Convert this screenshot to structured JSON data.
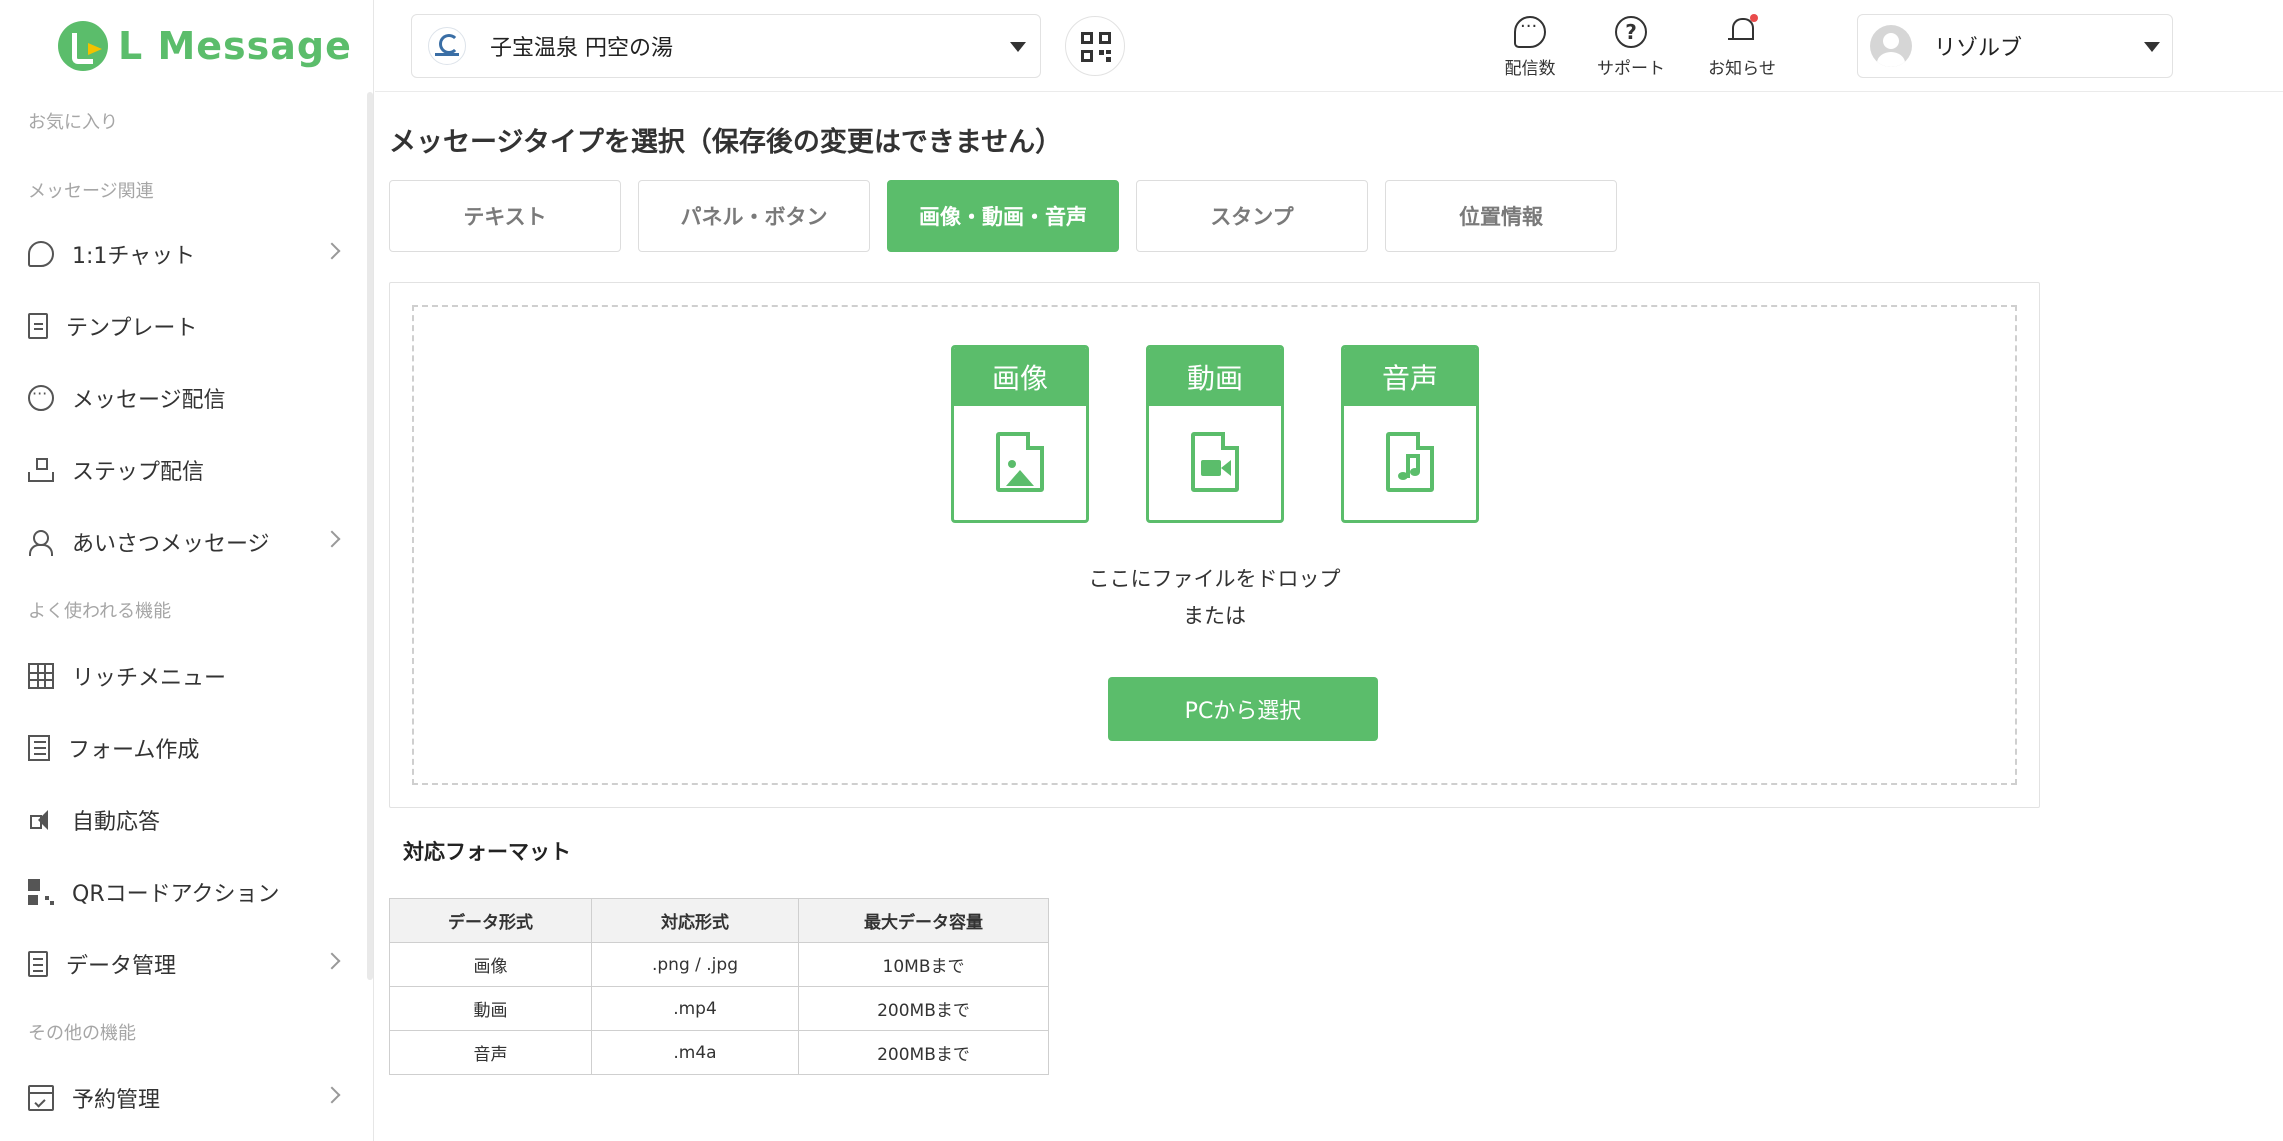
{
  "app": {
    "logo_text": "L Message",
    "accent_color": "#5bbd6b"
  },
  "sidebar": {
    "sections": [
      {
        "label": "お気に入り"
      },
      {
        "label": "メッセージ関連"
      },
      {
        "label": "よく使われる機能"
      },
      {
        "label": "その他の機能"
      }
    ],
    "items": [
      {
        "label": "1:1チャット",
        "icon": "chat-bubbles-icon",
        "has_submenu": true
      },
      {
        "label": "テンプレート",
        "icon": "document-icon",
        "has_submenu": false
      },
      {
        "label": "メッセージ配信",
        "icon": "message-icon",
        "has_submenu": false
      },
      {
        "label": "ステップ配信",
        "icon": "step-hierarchy-icon",
        "has_submenu": false
      },
      {
        "label": "あいさつメッセージ",
        "icon": "user-plus-icon",
        "has_submenu": true
      },
      {
        "label": "リッチメニュー",
        "icon": "grid-icon",
        "has_submenu": false
      },
      {
        "label": "フォーム作成",
        "icon": "form-icon",
        "has_submenu": false
      },
      {
        "label": "自動応答",
        "icon": "speaker-icon",
        "has_submenu": false
      },
      {
        "label": "QRコードアクション",
        "icon": "qr-code-icon",
        "has_submenu": false
      },
      {
        "label": "データ管理",
        "icon": "data-icon",
        "has_submenu": true
      },
      {
        "label": "予約管理",
        "icon": "calendar-icon",
        "has_submenu": true
      }
    ]
  },
  "header": {
    "account_name": "子宝温泉 円空の湯",
    "tools": [
      {
        "label": "配信数",
        "icon": "chat-icon"
      },
      {
        "label": "サポート",
        "icon": "help-icon"
      },
      {
        "label": "お知らせ",
        "icon": "bell-icon",
        "has_notification": true
      }
    ],
    "user_name": "リゾルブ"
  },
  "main": {
    "section_title": "メッセージタイプを選択（保存後の変更はできません）",
    "tabs": [
      {
        "label": "テキスト",
        "active": false
      },
      {
        "label": "パネル・ボタン",
        "active": false
      },
      {
        "label": "画像・動画・音声",
        "active": true
      },
      {
        "label": "スタンプ",
        "active": false
      },
      {
        "label": "位置情報",
        "active": false
      }
    ],
    "media_cards": [
      {
        "label": "画像",
        "icon": "image-file-icon"
      },
      {
        "label": "動画",
        "icon": "video-file-icon"
      },
      {
        "label": "音声",
        "icon": "audio-file-icon"
      }
    ],
    "drop_text": "ここにファイルをドロップ",
    "or_text": "または",
    "select_button": "PCから選択",
    "formats_title": "対応フォーマット",
    "formats_table": {
      "headers": [
        "データ形式",
        "対応形式",
        "最大データ容量"
      ],
      "rows": [
        [
          "画像",
          ".png / .jpg",
          "10MBまで"
        ],
        [
          "動画",
          ".mp4",
          "200MBまで"
        ],
        [
          "音声",
          ".m4a",
          "200MBまで"
        ]
      ]
    }
  }
}
